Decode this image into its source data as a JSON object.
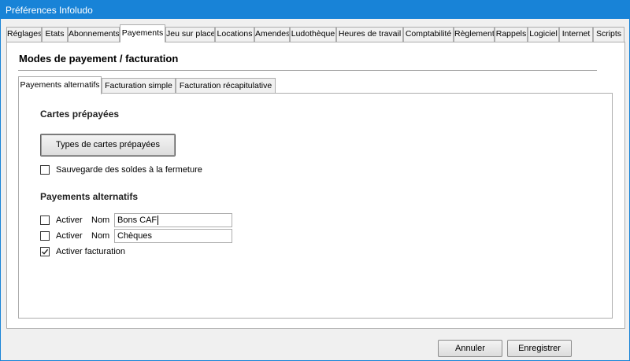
{
  "window": {
    "title": "Préférences Infoludo"
  },
  "tabs": [
    {
      "label": "Réglages"
    },
    {
      "label": "Etats"
    },
    {
      "label": "Abonnements"
    },
    {
      "label": "Payements"
    },
    {
      "label": "Jeu sur place"
    },
    {
      "label": "Locations"
    },
    {
      "label": "Amendes"
    },
    {
      "label": "Ludothèque"
    },
    {
      "label": "Heures de travail"
    },
    {
      "label": "Comptabilité"
    },
    {
      "label": "Règlement"
    },
    {
      "label": "Rappels"
    },
    {
      "label": "Logiciel"
    },
    {
      "label": "Internet"
    },
    {
      "label": "Scripts"
    }
  ],
  "active_tab": "Payements",
  "main": {
    "title": "Modes de payement / facturation",
    "subtabs": [
      {
        "label": "Payements alternatifs"
      },
      {
        "label": "Facturation simple"
      },
      {
        "label": "Facturation récapitulative"
      }
    ],
    "active_subtab": "Payements alternatifs",
    "prepaid": {
      "heading": "Cartes prépayées",
      "types_button": "Types de cartes prépayées",
      "save_balances_label": "Sauvegarde des soldes à la fermeture",
      "save_balances_checked": false
    },
    "alt": {
      "heading": "Payements alternatifs",
      "rows": [
        {
          "activate_label": "Activer",
          "name_label": "Nom",
          "value": "Bons CAF",
          "checked": false
        },
        {
          "activate_label": "Activer",
          "name_label": "Nom",
          "value": "Chèques",
          "checked": false
        }
      ],
      "billing_label": "Activer facturation",
      "billing_checked": true
    }
  },
  "footer": {
    "cancel_label": "Annuler",
    "save_label": "Enregistrer"
  }
}
